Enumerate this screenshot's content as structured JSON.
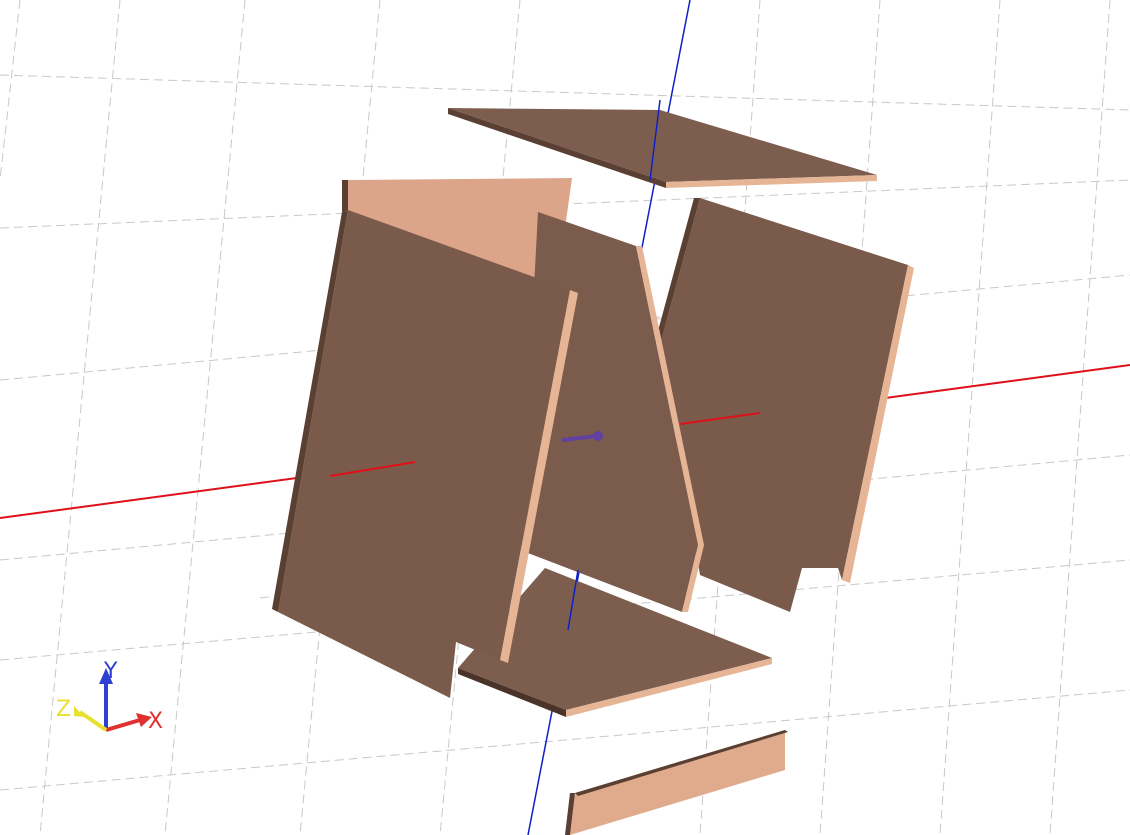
{
  "viewport": {
    "background": "#ffffff",
    "grid_color": "#c8c8c8",
    "panel_face_color": "#7a5a4b",
    "panel_edge_color": "#e6b596",
    "panel_light_face_color": "#dca488"
  },
  "world_axes": {
    "x_color": "#e0101a",
    "y_color": "#1020c8",
    "z_color": "#6040a0"
  },
  "orientation_triad": {
    "x_label": "X",
    "y_label": "Y",
    "z_label": "Z",
    "x_color": "#e03030",
    "y_color": "#3040d0",
    "z_color": "#e8e030"
  },
  "model": {
    "panels": [
      "top-panel",
      "back-panel",
      "left-side-panel",
      "middle-divider-panel",
      "right-side-panel",
      "bottom-panel",
      "loose-panel"
    ]
  }
}
